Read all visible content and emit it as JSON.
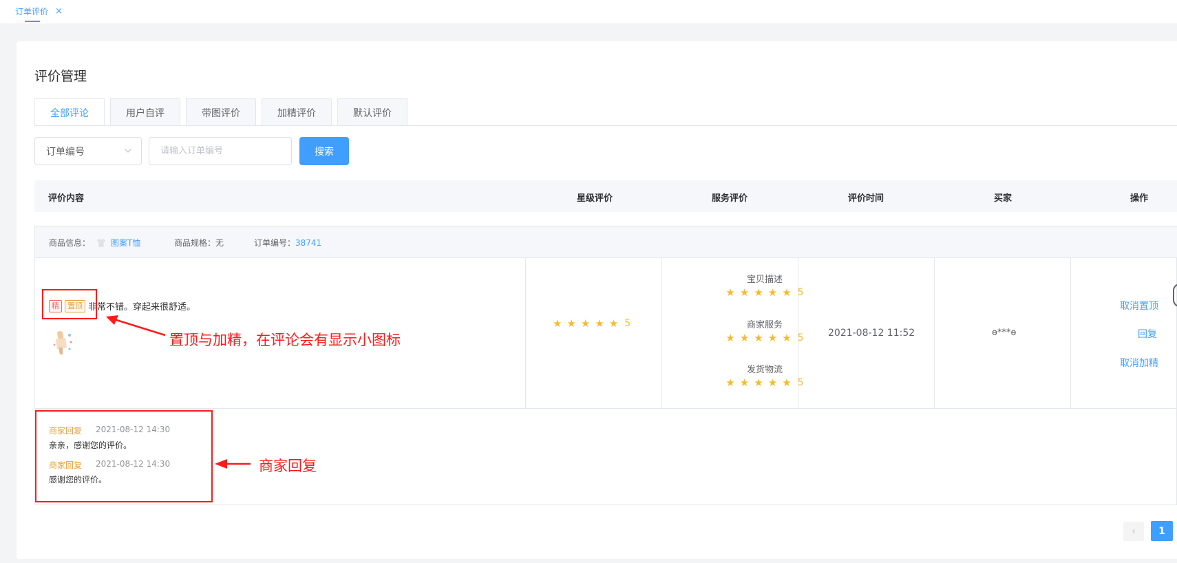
{
  "topbar": {
    "tab_label": "订单评价",
    "close": "×"
  },
  "page": {
    "title": "评价管理"
  },
  "tabs": [
    {
      "label": "全部评论"
    },
    {
      "label": "用户自评"
    },
    {
      "label": "带图评价"
    },
    {
      "label": "加精评价"
    },
    {
      "label": "默认评价"
    }
  ],
  "search": {
    "select_value": "订单编号",
    "placeholder": "请输入订单编号",
    "button": "搜索"
  },
  "table": {
    "headers": [
      "评价内容",
      "星级评价",
      "服务评价",
      "评价时间",
      "买家",
      "操作"
    ]
  },
  "order": {
    "product_label": "商品信息：",
    "product_name": "图案T恤",
    "spec_label": "商品规格：无",
    "order_no_label": "订单编号：",
    "order_no": "38741",
    "badge_jing": "精",
    "badge_top": "置顶",
    "comment": "非常不错。穿起来很舒适。",
    "rating": "5",
    "services": [
      {
        "label": "宝贝描述",
        "score": "5"
      },
      {
        "label": "商家服务",
        "score": "5"
      },
      {
        "label": "发货物流",
        "score": "5"
      }
    ],
    "time": "2021-08-12 11:52",
    "buyer": "ɵ***ɵ",
    "ops": [
      "取消置顶",
      "回复",
      "取消加精"
    ],
    "replies": [
      {
        "who": "商家回复",
        "time": "2021-08-12 14:30",
        "text": "亲亲，感谢您的评价。"
      },
      {
        "who": "商家回复",
        "time": "2021-08-12 14:30",
        "text": "感谢您的评价。"
      }
    ]
  },
  "annotations": {
    "badges_note": "置顶与加精，在评论会有显示小图标",
    "reply_note": "商家回复"
  },
  "pagination": {
    "prev": "‹",
    "current": "1"
  },
  "colors": {
    "accent": "#409eff",
    "star": "#f7ba2a",
    "annotation": "#ff1a1a"
  }
}
